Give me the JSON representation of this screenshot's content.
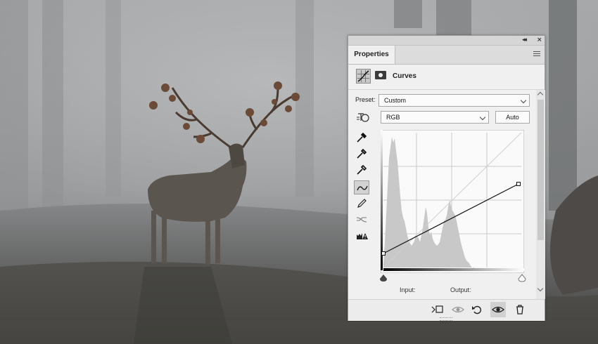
{
  "panel": {
    "tab_label": "Properties",
    "adjustment_title": "Curves",
    "preset_label": "Preset:",
    "preset_value": "Custom",
    "channel_value": "RGB",
    "auto_label": "Auto",
    "input_label": "Input:",
    "output_label": "Output:"
  },
  "icons": {
    "collapse": "◂◂",
    "close": "×"
  },
  "colors": {
    "curve_line": "#111111",
    "histogram": "#c8c8c8",
    "panel_bg": "#f0f0f0"
  }
}
